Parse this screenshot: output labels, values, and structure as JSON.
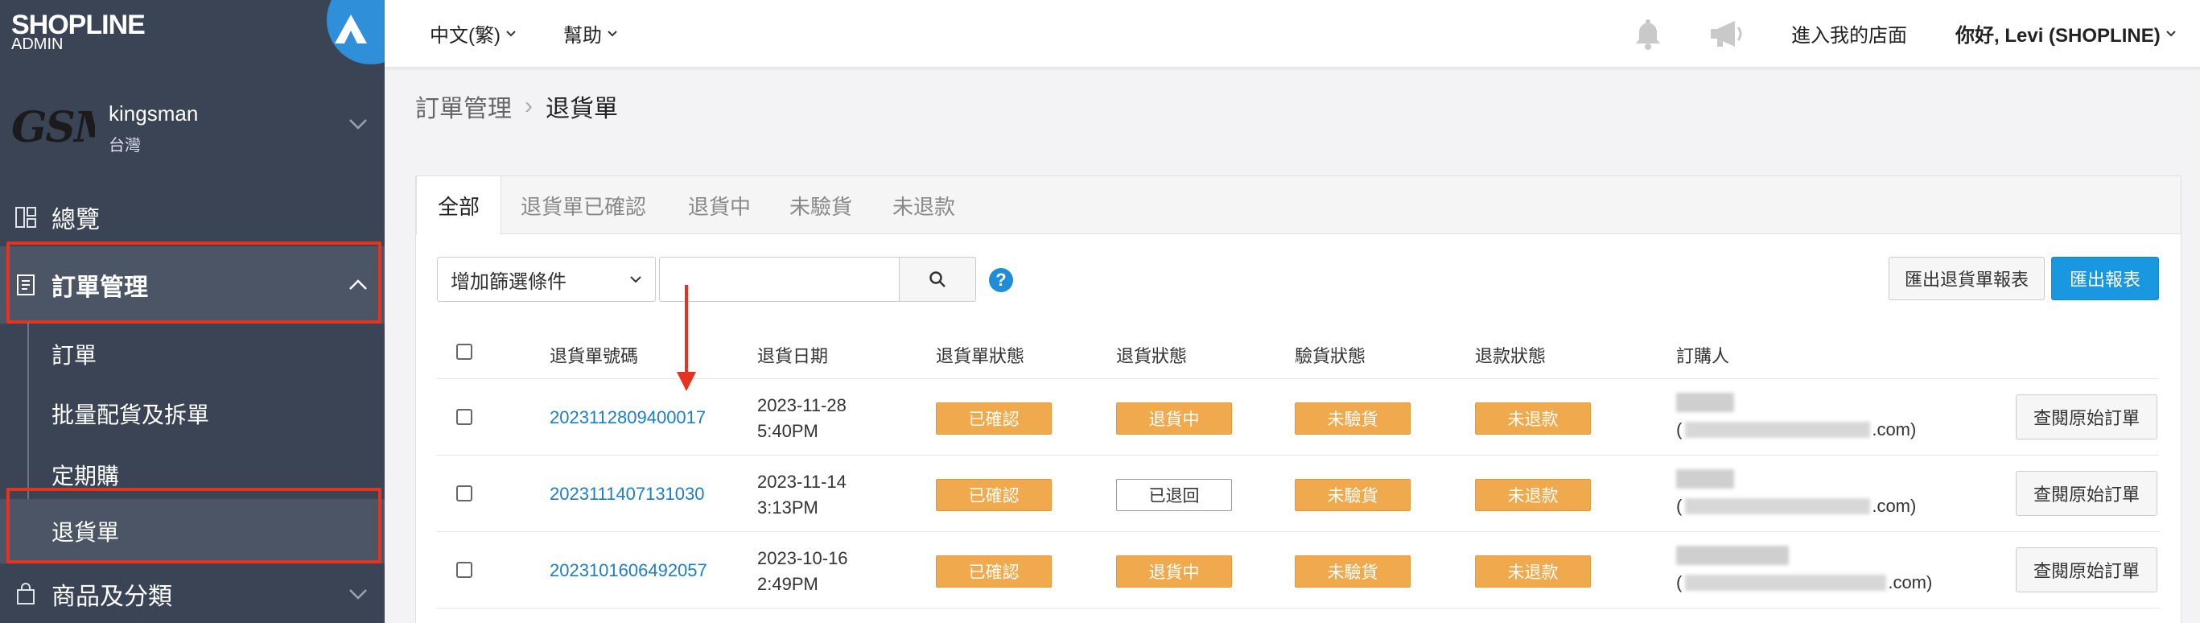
{
  "brand": {
    "name": "SHOPLINE",
    "sub": "ADMIN"
  },
  "store": {
    "logo_text": "GSM",
    "name": "kingsman",
    "country": "台灣"
  },
  "sidebar": {
    "items": [
      {
        "label": "總覽",
        "icon": "dashboard-icon"
      },
      {
        "label": "訂單管理",
        "icon": "document-icon",
        "expanded": true
      },
      {
        "label": "商品及分類",
        "icon": "shopping-bag-icon"
      }
    ],
    "subitems": [
      "訂單",
      "批量配貨及拆單",
      "定期購",
      "退貨單"
    ]
  },
  "topbar": {
    "language": "中文(繁)",
    "help": "幫助",
    "enter_store": "進入我的店面",
    "greeting": "你好, Levi (SHOPLINE)"
  },
  "breadcrumb": {
    "parent": "訂單管理",
    "separator": "›",
    "current": "退貨單"
  },
  "tabs": [
    "全部",
    "退貨單已確認",
    "退貨中",
    "未驗貨",
    "未退款"
  ],
  "filter": {
    "select_label": "增加篩選條件",
    "help": "?"
  },
  "buttons": {
    "export_return": "匯出退貨單報表",
    "export": "匯出報表",
    "view_order": "查閱原始訂單"
  },
  "table": {
    "headers": [
      "退貨單號碼",
      "退貨日期",
      "退貨單狀態",
      "退貨狀態",
      "驗貨狀態",
      "退款狀態",
      "訂購人"
    ],
    "rows": [
      {
        "number": "2023112809400017",
        "date": "2023-11-28",
        "time": "5:40PM",
        "order_status": "已確認",
        "return_status": "退貨中",
        "inspection": "未驗貨",
        "refund": "未退款",
        "email_suffix": ".com)"
      },
      {
        "number": "2023111407131030",
        "date": "2023-11-14",
        "time": "3:13PM",
        "order_status": "已確認",
        "return_status": "已退回",
        "inspection": "未驗貨",
        "refund": "未退款",
        "email_suffix": ".com)"
      },
      {
        "number": "2023101606492057",
        "date": "2023-10-16",
        "time": "2:49PM",
        "order_status": "已確認",
        "return_status": "退貨中",
        "inspection": "未驗貨",
        "refund": "未退款",
        "email_suffix": ".com)"
      }
    ]
  },
  "colors": {
    "sidebar": "#3a4454",
    "accent": "#1a97e1",
    "badge": "#f0a94c",
    "highlight": "#e5331f"
  }
}
